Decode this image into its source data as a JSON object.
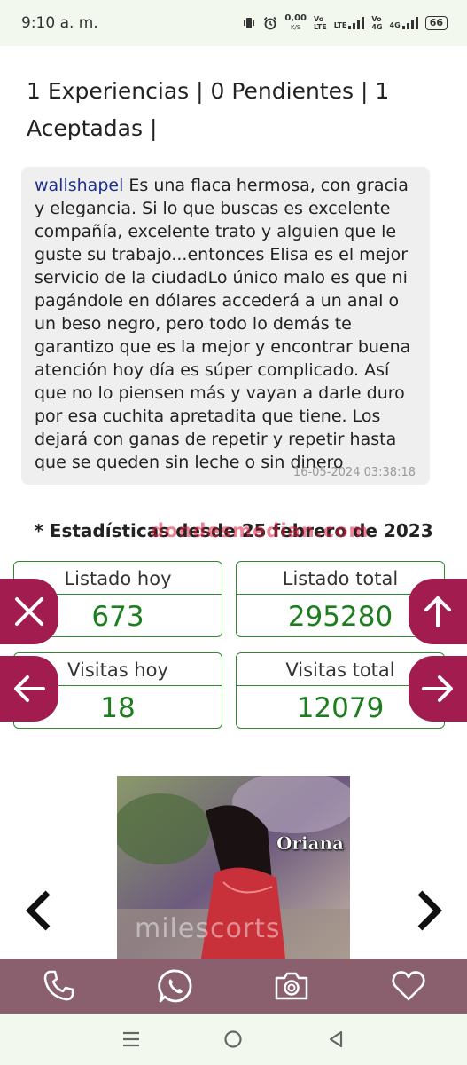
{
  "status_bar": {
    "time": "9:10 a. m.",
    "speed": "0,00",
    "speed_unit": "K/S",
    "network1_top": "Vo",
    "network1_bottom": "LTE",
    "network1_type": "LTE",
    "network2_top": "Vo",
    "network2_bottom": "4G",
    "network2_type": "4G",
    "battery": "66"
  },
  "summary": {
    "heading": "1 Experiencias | 0 Pendientes | 1 Aceptadas |"
  },
  "comment": {
    "user": "wallshapel",
    "text": " Es una flaca hermosa, con gracia y elegancia. Si lo que buscas es excelente compañía, excelente trato y alguien que le guste su trabajo...entonces Elisa es el mejor servicio de la ciudadLo único malo es que ni pagándole en dólares accederá a un anal o un beso negro, pero todo lo demás te garantizo que es la mejor y encontrar buena atención hoy día es súper complicado. Así que no lo piensen más y vayan a darle duro por esa cuchita apretadita que tiene. Los dejará con ganas de repetir y repetir hasta que se queden sin leche o sin dinero",
    "date": "16-05-2024 03:38:18"
  },
  "stats": {
    "title": "* Estadísticas desde 25 febrero de 2023",
    "watermark": "dondesmedian.com",
    "listado_hoy_label": "Listado hoy",
    "listado_hoy_value": "673",
    "listado_total_label": "Listado total",
    "listado_total_value": "295280",
    "visitas_hoy_label": "Visitas hoy",
    "visitas_hoy_value": "18",
    "visitas_total_label": "Visitas total",
    "visitas_total_value": "12079"
  },
  "photo": {
    "name_overlay": "Oriana",
    "watermark": "milescorts"
  },
  "colors": {
    "accent": "#a31c50",
    "stat_green": "#1e7d1e",
    "action_bar": "#8a5f6e"
  }
}
